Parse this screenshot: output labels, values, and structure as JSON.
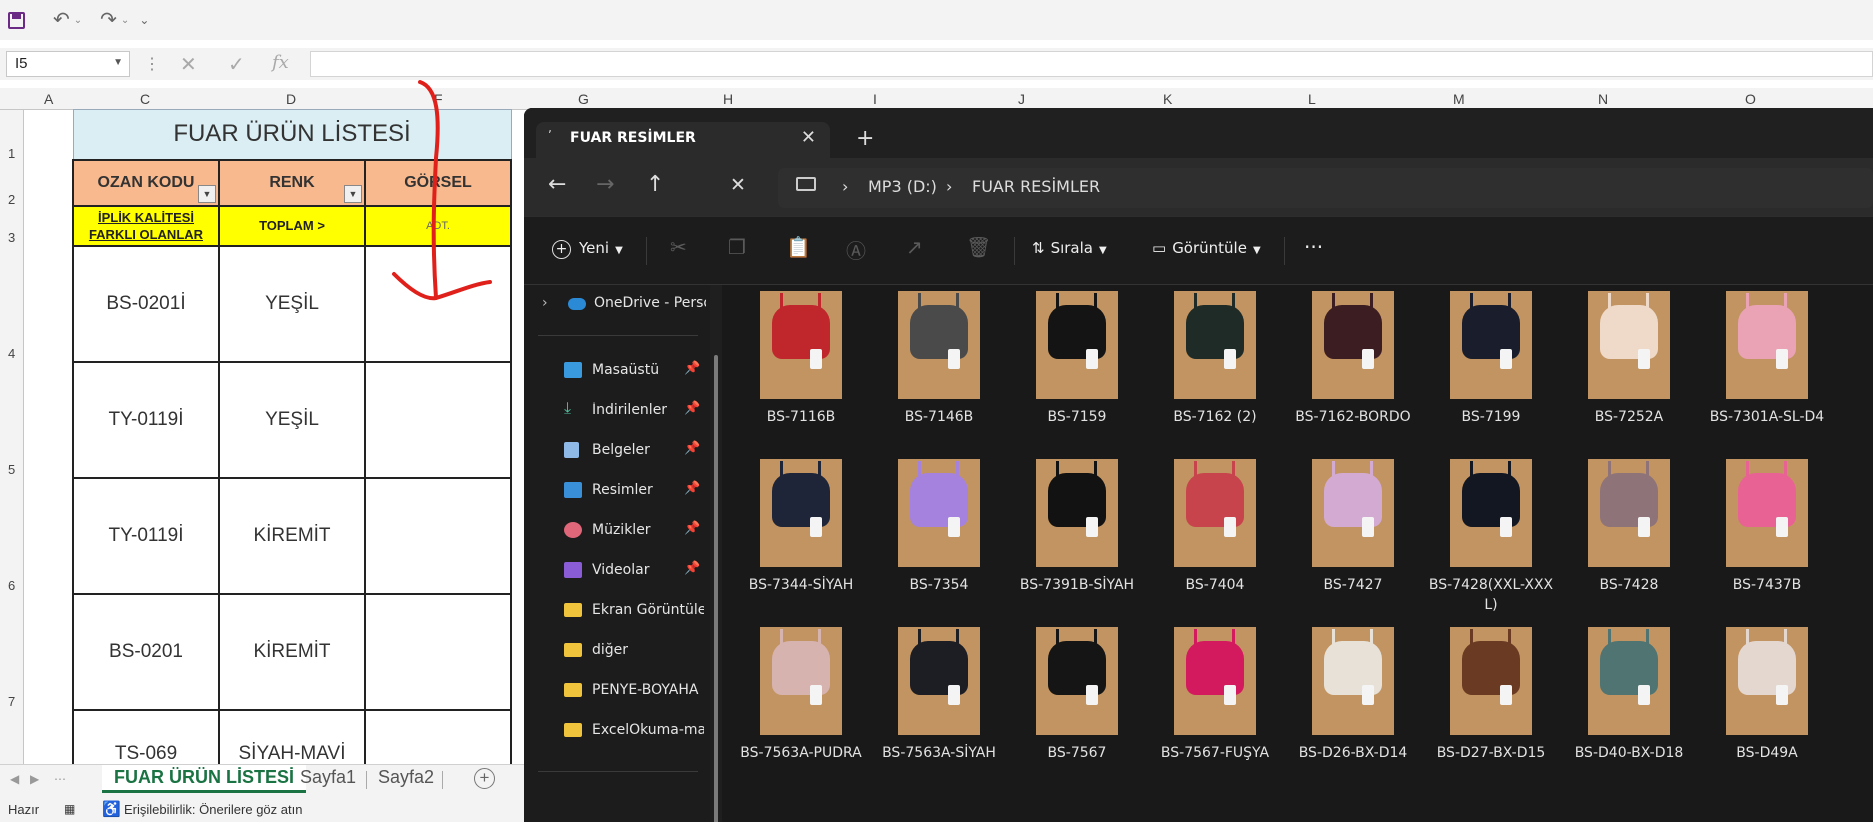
{
  "excel": {
    "name_box": "I5",
    "fx_label": "fx",
    "columns": [
      "A",
      "C",
      "D",
      "F",
      "G",
      "H",
      "I",
      "J",
      "K",
      "L",
      "M",
      "N",
      "O"
    ],
    "rows": [
      "1",
      "2",
      "3",
      "4",
      "5",
      "6",
      "7"
    ],
    "table": {
      "title": "FUAR ÜRÜN LİSTESİ",
      "headers": [
        "OZAN KODU",
        "RENK",
        "GÖRSEL"
      ],
      "summary": [
        "İPLİK KALİTESİ FARKLI OLANLAR",
        "TOPLAM >",
        "ADT."
      ],
      "rows": [
        {
          "code": "BS-0201İ",
          "color": "YEŞİL",
          "image": ""
        },
        {
          "code": "TY-0119İ",
          "color": "YEŞİL",
          "image": ""
        },
        {
          "code": "TY-0119İ",
          "color": "KİREMİT",
          "image": ""
        },
        {
          "code": "BS-0201",
          "color": "KİREMİT",
          "image": ""
        },
        {
          "code": "TS-069",
          "color": "SİYAH-MAVİ",
          "image": ""
        }
      ]
    },
    "sheet_tabs": [
      "FUAR ÜRÜN LİSTESİ",
      "Sayfa1",
      "Sayfa2"
    ],
    "status": {
      "ready": "Hazır",
      "accessibility": "Erişilebilirlik: Önerilere göz atın"
    },
    "colors": {
      "title_bg": "#daeef3",
      "header_bg": "#f8b98e",
      "summary_bg": "#ffff00",
      "active_tab": "#1a7343",
      "annotation": "#e0201b"
    }
  },
  "explorer": {
    "tab_title": "FUAR RESİMLER",
    "breadcrumb": [
      "MP3 (D:)",
      "FUAR RESİMLER"
    ],
    "toolbar": {
      "new": "Yeni",
      "sort": "Sırala",
      "view": "Görüntüle",
      "more": "···"
    },
    "nav": [
      {
        "label": "OneDrive - Perso",
        "icon": "cloud-icon",
        "pinned": false
      },
      {
        "label": "Masaüstü",
        "icon": "desktop-icon",
        "pinned": true
      },
      {
        "label": "İndirilenler",
        "icon": "download-icon",
        "pinned": true
      },
      {
        "label": "Belgeler",
        "icon": "documents-icon",
        "pinned": true
      },
      {
        "label": "Resimler",
        "icon": "pictures-icon",
        "pinned": true
      },
      {
        "label": "Müzikler",
        "icon": "music-icon",
        "pinned": true
      },
      {
        "label": "Videolar",
        "icon": "videos-icon",
        "pinned": true
      },
      {
        "label": "Ekran Görüntüle",
        "icon": "folder-icon",
        "pinned": false
      },
      {
        "label": "diğer",
        "icon": "folder-icon",
        "pinned": false
      },
      {
        "label": "PENYE-BOYAHA",
        "icon": "folder-icon",
        "pinned": false
      },
      {
        "label": "ExcelOkuma-ma",
        "icon": "folder-icon",
        "pinned": false
      }
    ],
    "files": [
      {
        "name": "BS-7116B",
        "color": "#c0272d"
      },
      {
        "name": "BS-7146B",
        "color": "#4a4a4a"
      },
      {
        "name": "BS-7159",
        "color": "#141414"
      },
      {
        "name": "BS-7162 (2)",
        "color": "#1e2b26"
      },
      {
        "name": "BS-7162-BORDO",
        "color": "#3b1d22"
      },
      {
        "name": "BS-7199",
        "color": "#1a1e2c"
      },
      {
        "name": "BS-7252A",
        "color": "#efd9c8"
      },
      {
        "name": "BS-7301A-SL-D4",
        "color": "#e9a3b5"
      },
      {
        "name": "BS-7344-SİYAH",
        "color": "#1f2538"
      },
      {
        "name": "BS-7354",
        "color": "#a582de"
      },
      {
        "name": "BS-7391B-SİYAH",
        "color": "#121212"
      },
      {
        "name": "BS-7404",
        "color": "#c8444c"
      },
      {
        "name": "BS-7427",
        "color": "#d3abd2"
      },
      {
        "name": "BS-7428(XXL-XXXL)",
        "color": "#131722"
      },
      {
        "name": "BS-7428",
        "color": "#8e7378"
      },
      {
        "name": "BS-7437B",
        "color": "#e86394"
      },
      {
        "name": "BS-7563A-PUDRA",
        "color": "#d7b3b0"
      },
      {
        "name": "BS-7563A-SİYAH",
        "color": "#1d1d24"
      },
      {
        "name": "BS-7567",
        "color": "#151515"
      },
      {
        "name": "BS-7567-FUŞYA",
        "color": "#d41a5e"
      },
      {
        "name": "BS-D26-BX-D14",
        "color": "#e7e1d7"
      },
      {
        "name": "BS-D27-BX-D15",
        "color": "#6a3a22"
      },
      {
        "name": "BS-D40-BX-D18",
        "color": "#4f7472"
      },
      {
        "name": "BS-D49A",
        "color": "#e4d7d0"
      }
    ]
  }
}
